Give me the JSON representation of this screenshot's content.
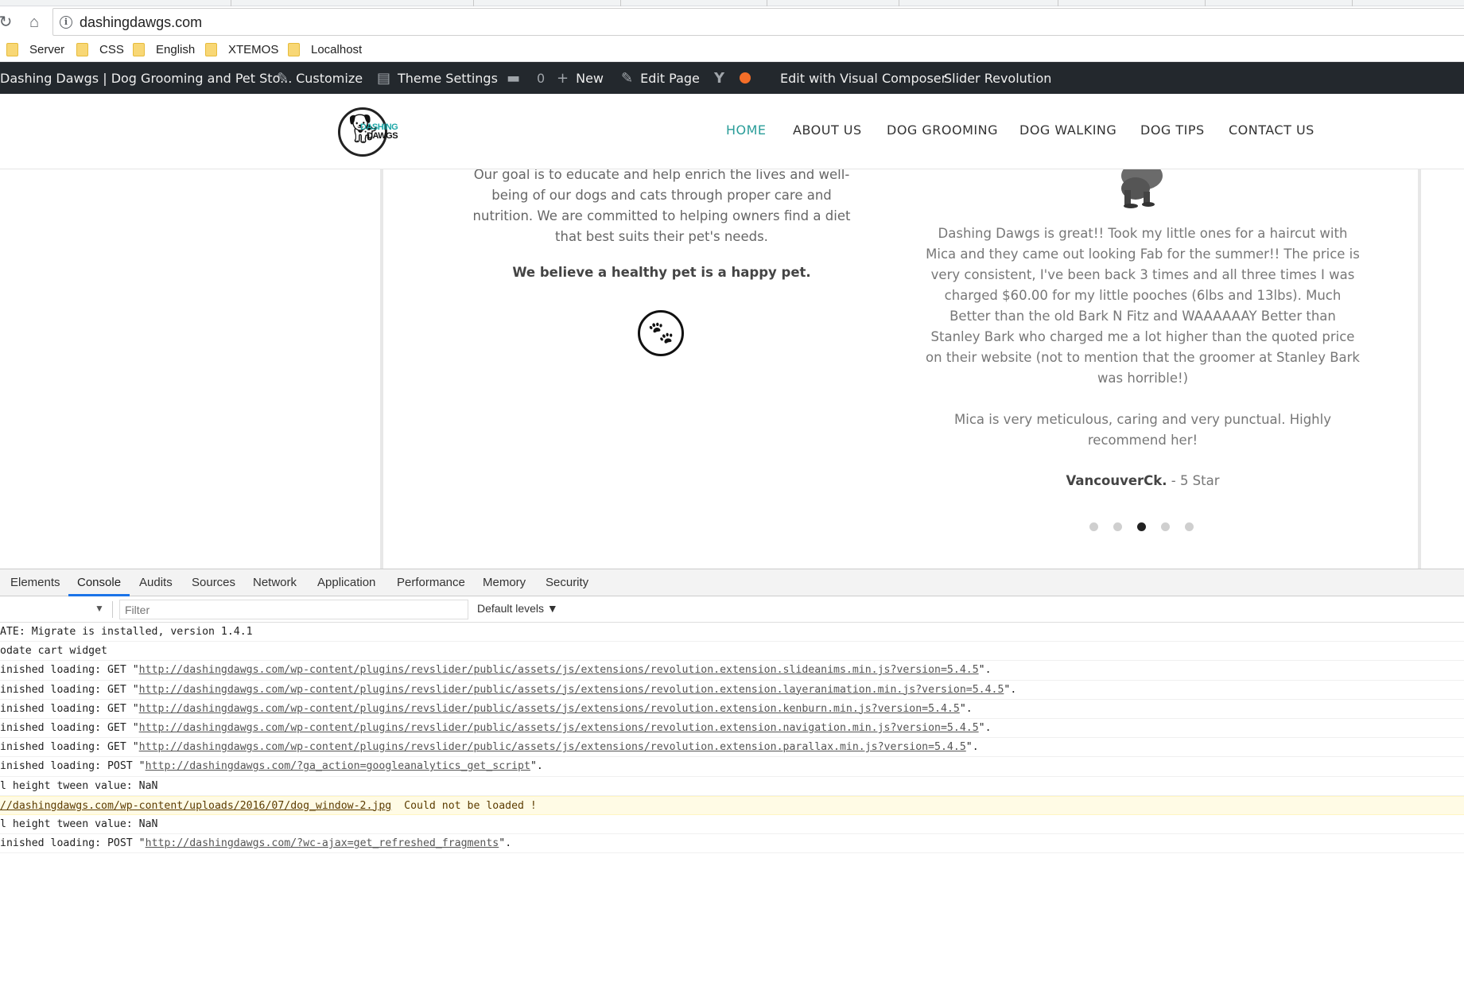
{
  "browser": {
    "url": "dashingdawgs.com",
    "bookmarks": [
      "Server",
      "CSS",
      "English",
      "XTEMOS",
      "Localhost"
    ]
  },
  "adminbar": {
    "site_title": "Dashing Dawgs | Dog Grooming and Pet Sto...",
    "customize": "Customize",
    "theme_settings": "Theme Settings",
    "comments_count": "0",
    "new": "New",
    "edit_page": "Edit Page",
    "visual_composer": "Edit with Visual Composer",
    "slider_revolution": "Slider Revolution"
  },
  "site": {
    "logo_word1": "DASHING",
    "logo_word2": "DAWGS",
    "menu": [
      "HOME",
      "ABOUT US",
      "DOG GROOMING",
      "DOG WALKING",
      "DOG TIPS",
      "CONTACT US"
    ],
    "mission": "Our goal is to educate and help enrich the lives and well-being of our dogs and cats through proper care and nutrition. We are committed to helping owners find a diet that best suits their pet's needs.",
    "believe": "We believe a healthy pet is a happy pet.",
    "testimonial_p1": "Dashing Dawgs is great!! Took my little ones for a haircut with Mica and they came out looking Fab for the summer!! The price is very consistent, I've been back 3 times and all three times I was charged $60.00 for my little pooches (6lbs and 13lbs). Much Better than the old Bark N Fitz and WAAAAAAY Better than Stanley Bark who charged me a lot higher than the quoted price on their website (not to mention that the groomer at Stanley Bark was horrible!)",
    "testimonial_p2": "Mica is very meticulous, caring and very punctual. Highly recommend her!",
    "author_name": "VancouverCk.",
    "author_rating": " - 5 Star",
    "slider_dots_total": 5,
    "slider_dots_active_index": 2
  },
  "devtools": {
    "tabs": [
      "Elements",
      "Console",
      "Audits",
      "Sources",
      "Network",
      "Application",
      "Performance",
      "Memory",
      "Security"
    ],
    "active_tab": "Console",
    "filter_placeholder": "Filter",
    "levels": "Default levels",
    "console_lines": [
      {
        "prefix": "ATE: Migrate is installed, version 1.4.1",
        "link": "",
        "suffix": "",
        "type": "log"
      },
      {
        "prefix": "odate cart widget",
        "link": "",
        "suffix": "",
        "type": "log"
      },
      {
        "prefix": "inished loading: GET \"",
        "link": "http://dashingdawgs.com/wp-content/plugins/revslider/public/assets/js/extensions/revolution.extension.slideanims.min.js?version=5.4.5",
        "suffix": "\".",
        "type": "log"
      },
      {
        "prefix": "inished loading: GET \"",
        "link": "http://dashingdawgs.com/wp-content/plugins/revslider/public/assets/js/extensions/revolution.extension.layeranimation.min.js?version=5.4.5",
        "suffix": "\".",
        "type": "log"
      },
      {
        "prefix": "inished loading: GET \"",
        "link": "http://dashingdawgs.com/wp-content/plugins/revslider/public/assets/js/extensions/revolution.extension.kenburn.min.js?version=5.4.5",
        "suffix": "\".",
        "type": "log"
      },
      {
        "prefix": "inished loading: GET \"",
        "link": "http://dashingdawgs.com/wp-content/plugins/revslider/public/assets/js/extensions/revolution.extension.navigation.min.js?version=5.4.5",
        "suffix": "\".",
        "type": "log"
      },
      {
        "prefix": "inished loading: GET \"",
        "link": "http://dashingdawgs.com/wp-content/plugins/revslider/public/assets/js/extensions/revolution.extension.parallax.min.js?version=5.4.5",
        "suffix": "\".",
        "type": "log"
      },
      {
        "prefix": "inished loading: POST \"",
        "link": "http://dashingdawgs.com/?ga_action=googleanalytics_get_script",
        "suffix": "\".",
        "type": "log"
      },
      {
        "prefix": "l height tween value: NaN",
        "link": "",
        "suffix": "",
        "type": "log"
      },
      {
        "prefix": "",
        "link": "//dashingdawgs.com/wp-content/uploads/2016/07/dog_window-2.jpg",
        "suffix": "  Could not be loaded !",
        "type": "warn"
      },
      {
        "prefix": "l height tween value: NaN",
        "link": "",
        "suffix": "",
        "type": "log"
      },
      {
        "prefix": "inished loading: POST \"",
        "link": "http://dashingdawgs.com/?wc-ajax=get_refreshed_fragments",
        "suffix": "\".",
        "type": "log"
      }
    ]
  }
}
